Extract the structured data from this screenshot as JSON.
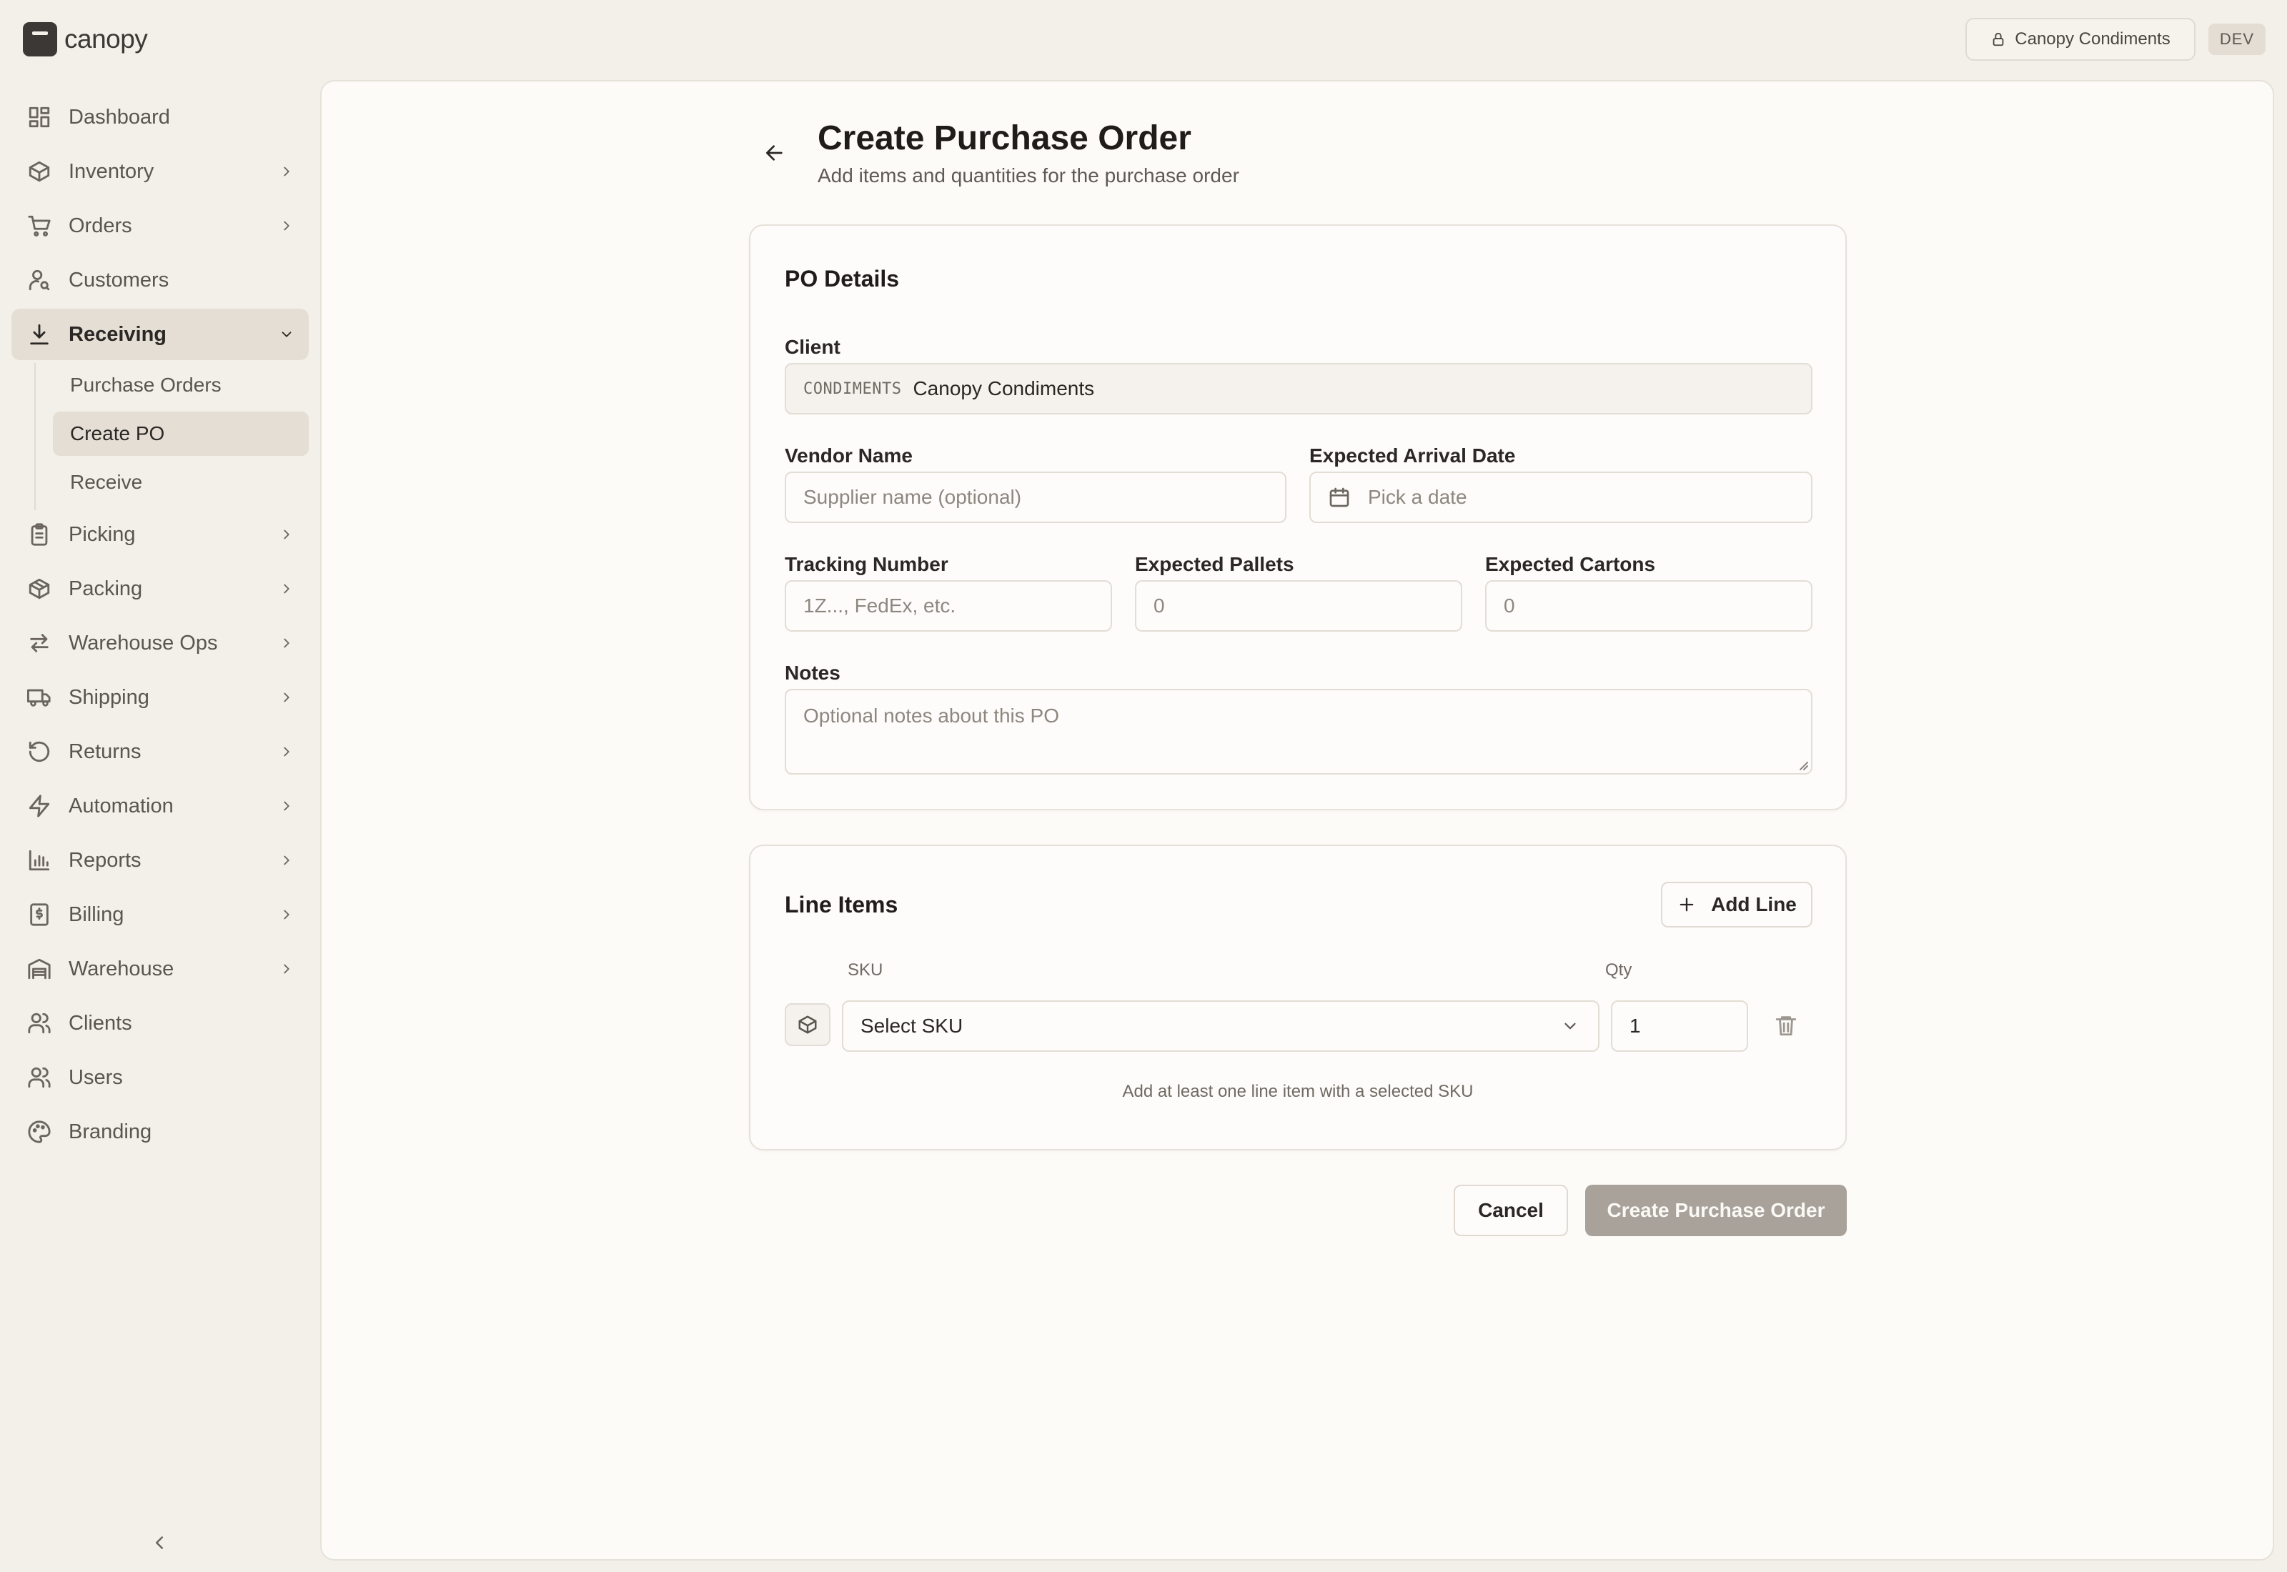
{
  "app": {
    "name": "canopy"
  },
  "topbar": {
    "client_name": "Canopy Condiments",
    "env_badge": "DEV"
  },
  "sidebar": {
    "items": [
      {
        "label": "Dashboard",
        "icon": "layout-grid-icon"
      },
      {
        "label": "Inventory",
        "icon": "box-icon"
      },
      {
        "label": "Orders",
        "icon": "cart-icon"
      },
      {
        "label": "Customers",
        "icon": "user-search-icon"
      },
      {
        "label": "Receiving",
        "icon": "download-icon"
      },
      {
        "label": "Picking",
        "icon": "clipboard-icon"
      },
      {
        "label": "Packing",
        "icon": "package-icon"
      },
      {
        "label": "Warehouse Ops",
        "icon": "arrows-icon"
      },
      {
        "label": "Shipping",
        "icon": "truck-icon"
      },
      {
        "label": "Returns",
        "icon": "rotate-icon"
      },
      {
        "label": "Automation",
        "icon": "zap-icon"
      },
      {
        "label": "Reports",
        "icon": "bar-chart-icon"
      },
      {
        "label": "Billing",
        "icon": "receipt-icon"
      },
      {
        "label": "Warehouse",
        "icon": "warehouse-icon"
      },
      {
        "label": "Clients",
        "icon": "users-icon"
      },
      {
        "label": "Users",
        "icon": "users-icon"
      },
      {
        "label": "Branding",
        "icon": "palette-icon"
      }
    ],
    "receiving_sub": [
      {
        "label": "Purchase Orders"
      },
      {
        "label": "Create PO"
      },
      {
        "label": "Receive"
      }
    ]
  },
  "page": {
    "title": "Create Purchase Order",
    "subtitle": "Add items and quantities for the purchase order"
  },
  "po_details": {
    "title": "PO Details",
    "client_label": "Client",
    "client_code": "CONDIMENTS",
    "client_value": "Canopy Condiments",
    "vendor_label": "Vendor Name",
    "vendor_placeholder": "Supplier name (optional)",
    "arrival_label": "Expected Arrival Date",
    "arrival_placeholder": "Pick a date",
    "tracking_label": "Tracking Number",
    "tracking_placeholder": "1Z..., FedEx, etc.",
    "pallets_label": "Expected Pallets",
    "pallets_value": "0",
    "cartons_label": "Expected Cartons",
    "cartons_value": "0",
    "notes_label": "Notes",
    "notes_placeholder": "Optional notes about this PO"
  },
  "line_items": {
    "title": "Line Items",
    "add_line_label": "Add Line",
    "sku_header": "SKU",
    "qty_header": "Qty",
    "rows": [
      {
        "sku_placeholder": "Select SKU",
        "qty": "1"
      }
    ],
    "hint": "Add at least one line item with a selected SKU"
  },
  "actions": {
    "cancel_label": "Cancel",
    "submit_label": "Create Purchase Order"
  }
}
